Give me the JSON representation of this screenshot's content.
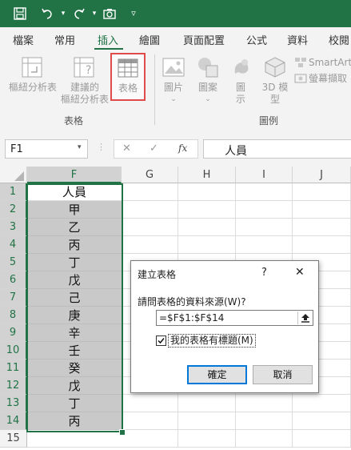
{
  "ribbon_tabs": [
    "檔案",
    "常用",
    "插入",
    "繪圖",
    "頁面配置",
    "公式",
    "資料",
    "校閱"
  ],
  "active_tab": "插入",
  "ribbon": {
    "pivot_table": "樞紐分析表",
    "recommended_pivot_line1": "建議的",
    "recommended_pivot_line2": "樞紐分析表",
    "table": "表格",
    "pictures": "圖片",
    "shapes": "圖案",
    "icons_line1": "圖",
    "icons_line2": "示",
    "models_line1": "3D 模",
    "models_line2": "型",
    "smartart": "SmartArt",
    "screenshot": "螢幕擷取",
    "group_tables": "表格",
    "group_illustrations": "圖例"
  },
  "formula_bar": {
    "name_box": "F1",
    "fx": "fx",
    "value": "人員"
  },
  "columns": [
    "F",
    "G",
    "H",
    "I",
    "J"
  ],
  "rows": [
    "1",
    "2",
    "3",
    "4",
    "5",
    "6",
    "7",
    "8",
    "9",
    "10",
    "11",
    "12",
    "13",
    "14",
    "15"
  ],
  "f_column": [
    "人員",
    "甲",
    "乙",
    "丙",
    "丁",
    "戊",
    "己",
    "庚",
    "辛",
    "壬",
    "癸",
    "戊",
    "丁",
    "丙",
    ""
  ],
  "dialog": {
    "title": "建立表格",
    "help": "?",
    "close": "✕",
    "prompt": "請問表格的資料來源(W)?",
    "range": "=$F$1:$F$14",
    "checkbox_label": "我的表格有標題(M)",
    "checkbox_checked": true,
    "ok": "確定",
    "cancel": "取消"
  },
  "colors": {
    "accent": "#217346",
    "highlight": "#e04a4a",
    "selection": "#c9c9c9"
  }
}
